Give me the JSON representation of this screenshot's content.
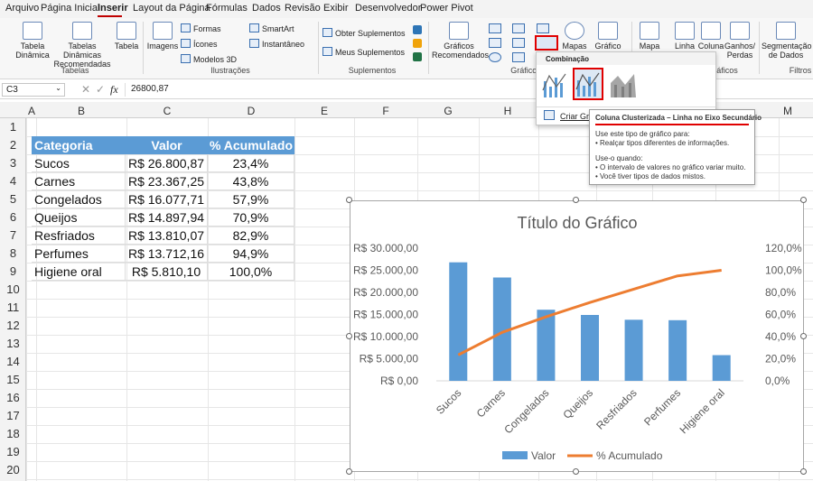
{
  "menu": [
    "Arquivo",
    "Página Inicial",
    "Inserir",
    "Layout da Página",
    "Fórmulas",
    "Dados",
    "Revisão",
    "Exibir",
    "Desenvolvedor",
    "Power Pivot"
  ],
  "ribbon": {
    "tabela_dinamica": "Tabela Dinâmica",
    "tabelas_recomendadas": "Tabelas Dinâmicas Recomendadas",
    "tabela": "Tabela",
    "imagens": "Imagens",
    "formas": "Formas",
    "icones": "Ícones",
    "modelos3d": "Modelos 3D",
    "smartart": "SmartArt",
    "instantaneo": "Instantâneo",
    "obter_suplementos": "Obter Suplementos",
    "meus_suplementos": "Meus Suplementos",
    "graficos_recomendados": "Gráficos Recomendados",
    "mapas": "Mapas",
    "grafico_dinamico": "Gráfico",
    "mapa3d": "Mapa",
    "linha": "Linha",
    "coluna": "Coluna",
    "ganhos_perdas": "Ganhos/ Perdas",
    "segmentacao": "Segmentação de Dados",
    "groups": {
      "tabelas": "Tabelas",
      "ilustracoes": "Ilustrações",
      "suplementos": "Suplementos",
      "graficos": "Gráficos",
      "minigraficos": "áficos",
      "filtros": "Filtros"
    }
  },
  "formula_bar": {
    "name_box": "C3",
    "fx": "fx",
    "value": "26800,87"
  },
  "columns": [
    "A",
    "B",
    "C",
    "D",
    "E",
    "F",
    "G",
    "H",
    "M"
  ],
  "rows": [
    "1",
    "2",
    "3",
    "4",
    "5",
    "6",
    "7",
    "8",
    "9",
    "10",
    "11",
    "12",
    "13",
    "14",
    "15",
    "16",
    "17",
    "18",
    "19",
    "20"
  ],
  "table": {
    "headers": [
      "Categoria",
      "Valor",
      "% Acumulado"
    ],
    "rows": [
      [
        "Sucos",
        "R$ 26.800,87",
        "23,4%"
      ],
      [
        "Carnes",
        "R$ 23.367,25",
        "43,8%"
      ],
      [
        "Congelados",
        "R$ 16.077,71",
        "57,9%"
      ],
      [
        "Queijos",
        "R$ 14.897,94",
        "70,9%"
      ],
      [
        "Resfriados",
        "R$ 13.810,07",
        "82,9%"
      ],
      [
        "Perfumes",
        "R$ 13.712,16",
        "94,9%"
      ],
      [
        "Higiene oral",
        "R$ 5.810,10",
        "100,0%"
      ]
    ]
  },
  "dropdown": {
    "title": "Combinação",
    "create_label": "Criar Grá"
  },
  "tooltip": {
    "title": "Coluna Clusterizada – Linha no Eixo Secundário",
    "line1": "Use este tipo de gráfico para:",
    "line2": "• Realçar tipos diferentes de informações.",
    "line3": "Use-o quando:",
    "line4": "• O intervalo de valores no gráfico variar muito.",
    "line5": "• Você tiver tipos de dados mistos."
  },
  "colors": {
    "bar": "#5b9bd5",
    "line": "#ed7d31",
    "header": "#5b9bd5",
    "highlight": "#e00000"
  },
  "chart_data": {
    "type": "bar",
    "title": "Título do Gráfico",
    "categories": [
      "Sucos",
      "Carnes",
      "Congelados",
      "Queijos",
      "Resfriados",
      "Perfumes",
      "Higiene oral"
    ],
    "series": [
      {
        "name": "Valor",
        "type": "bar",
        "axis": "primary",
        "values": [
          26800.87,
          23367.25,
          16077.71,
          14897.94,
          13810.07,
          13712.16,
          5810.1
        ]
      },
      {
        "name": "% Acumulado",
        "type": "line",
        "axis": "secondary",
        "values": [
          0.234,
          0.438,
          0.579,
          0.709,
          0.829,
          0.949,
          1.0
        ]
      }
    ],
    "y_ticks": [
      "R$ 0,00",
      "R$ 5.000,00",
      "R$ 10.000,00",
      "R$ 15.000,00",
      "R$ 20.000,00",
      "R$ 25.000,00",
      "R$ 30.000,00"
    ],
    "y2_ticks": [
      "0,0%",
      "20,0%",
      "40,0%",
      "60,0%",
      "80,0%",
      "100,0%",
      "120,0%"
    ],
    "ylim": [
      0,
      30000
    ],
    "y2lim": [
      0,
      1.2
    ],
    "legend": "bottom",
    "grid": false
  }
}
